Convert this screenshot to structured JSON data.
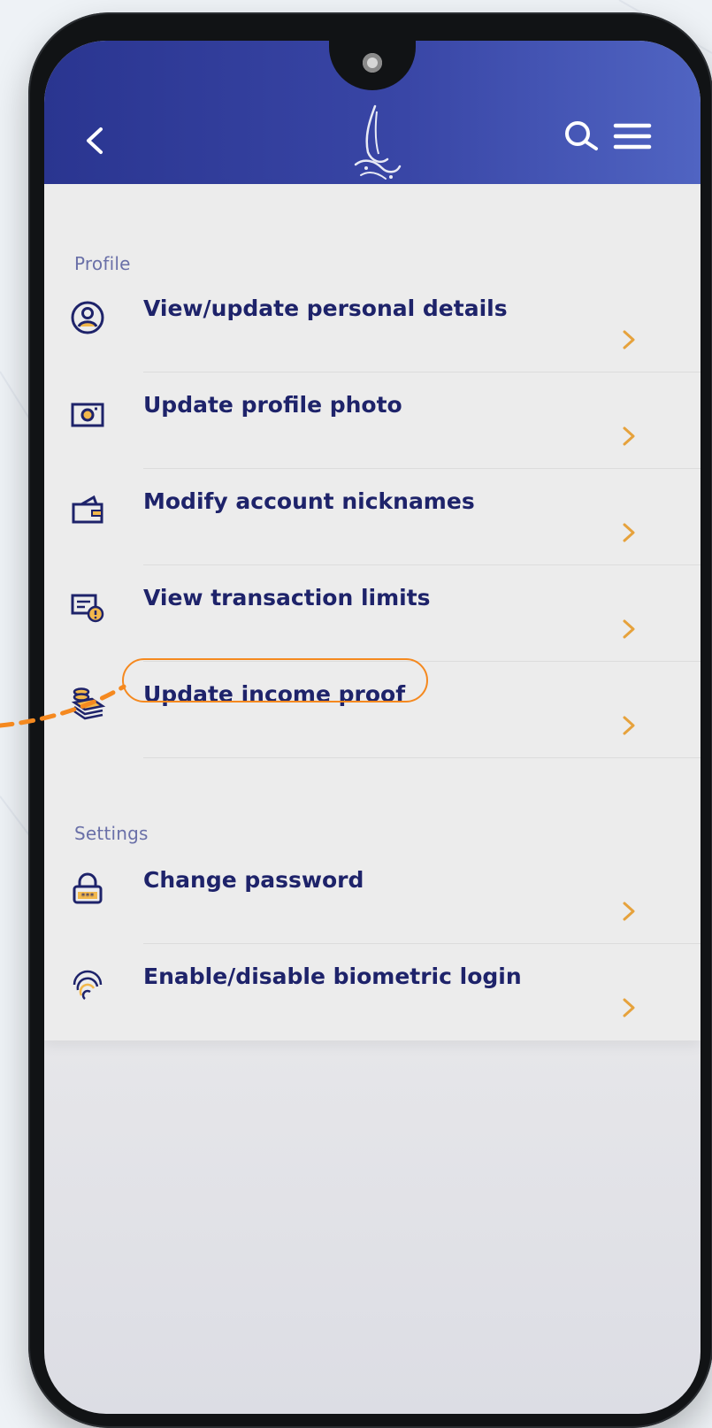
{
  "header": {
    "back_icon": "chevron-left-icon",
    "logo_icon": "calligraphy-logo-icon",
    "search_icon": "search-icon",
    "menu_icon": "hamburger-menu-icon",
    "colors": {
      "bar_start": "#2a3590",
      "bar_end": "#5064c2"
    }
  },
  "sections": {
    "profile": {
      "title": "Profile",
      "items": [
        {
          "label": "View/update personal details",
          "icon": "user-circle-icon"
        },
        {
          "label": "Update profile photo",
          "icon": "camera-icon"
        },
        {
          "label": "Modify account nicknames",
          "icon": "wallet-icon"
        },
        {
          "label": "View transaction limits",
          "icon": "limit-warning-icon"
        },
        {
          "label": "Update income proof",
          "icon": "money-stack-icon",
          "highlighted": true
        }
      ]
    },
    "settings": {
      "title": "Settings",
      "items": [
        {
          "label": "Change password",
          "icon": "lock-icon"
        },
        {
          "label": "Enable/disable biometric login",
          "icon": "fingerprint-icon"
        }
      ]
    }
  },
  "colors": {
    "label": "#1e236a",
    "section_title": "#6a70a8",
    "chevron": "#e6a23c",
    "callout": "#f5891f"
  }
}
